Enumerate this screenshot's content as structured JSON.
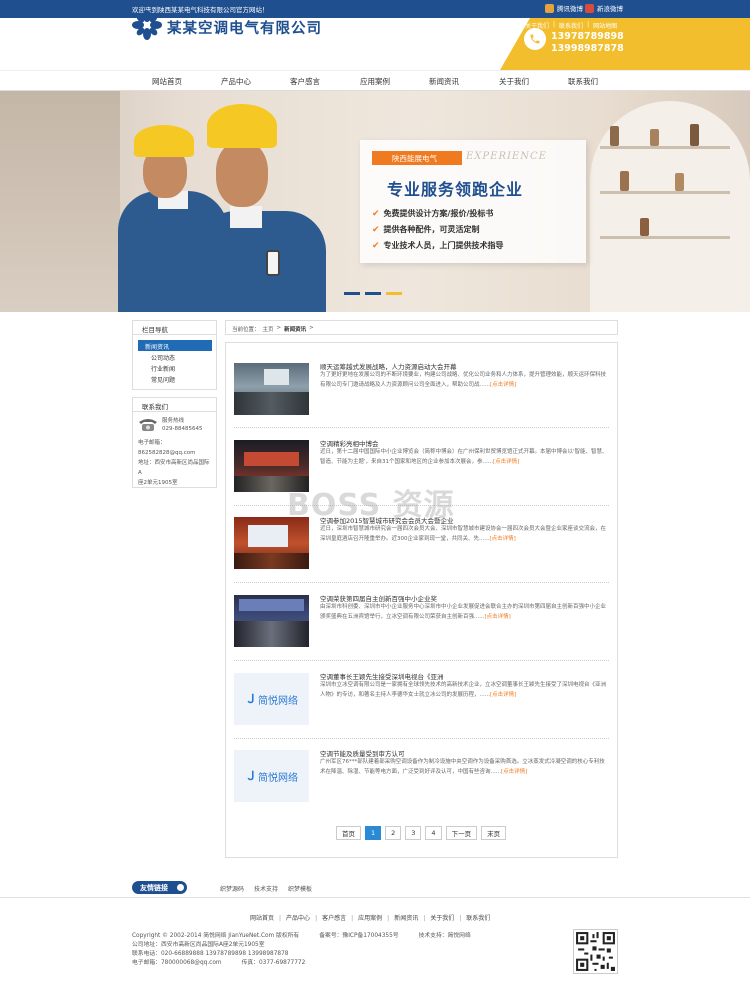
{
  "topbar": {
    "welcome": "欢迎来到陕西某某电气科技有限公司官方网站！",
    "tencent_weibo": "腾讯微博",
    "sina_weibo": "新浪微博"
  },
  "header": {
    "company_name": "某某空调电气有限公司",
    "links": [
      "关于我们",
      "联系我们",
      "网站地图"
    ],
    "phones": [
      "13978789898",
      "13998987878"
    ]
  },
  "nav": [
    "网站首页",
    "产品中心",
    "客户感言",
    "应用案例",
    "新闻资讯",
    "关于我们",
    "联系我们"
  ],
  "banner": {
    "tag": "陕西能展电气",
    "english": "EXPERIENCE",
    "title": "专业服务领跑企业",
    "points": [
      "免费提供设计方案/报价/投标书",
      "提供各种配件，可灵活定制",
      "专业技术人员，上门提供技术指导"
    ]
  },
  "sidebar": {
    "nav_title": "栏目导航",
    "category": "新闻资讯",
    "items": [
      "公司动态",
      "行业新闻",
      "常见问题"
    ],
    "contact_title": "联系我们",
    "hotline_label": "服务热线",
    "hotline": "029-88485645",
    "email_label": "电子邮箱：",
    "email": "862582828@qq.com",
    "address": "地址：西安市高新区尚品国际A",
    "address2": "座2单元1905室"
  },
  "breadcrumb": {
    "label": "当前位置：",
    "home": "主页",
    "current": "新闻资讯"
  },
  "articles": [
    {
      "title": "顺天运筹越式发展战略，人力资源启动大会开幕",
      "desc": "为了更好更地在发展公司的不断环境要业，构建公司战略、优化公司业务和人力体系，提升管理效能，顺天运环保科技有限公司专门邀请战略及人力资源顾问公司全面进入，帮助公司战......",
      "more": "[点击详情]"
    },
    {
      "title": "空调精彩亮相中博会",
      "desc": "近日，第十二届中国国际中小企业博览会（简称中博会）在广州保利世贸博览馆正式开幕。本届中博会以'智能、智慧、智造、节能为主题'，来自31个国家和地区的企业参加本次展会，参......",
      "more": "[点击详情]"
    },
    {
      "title": "空调参加2015智慧城市研究会会员大会暨企业",
      "desc": "近日，深圳市智慧城市研究会一届四次会员大会、深圳市智慧城市建设协会一届四次会员大会暨企业家座谈交流会，在深圳皇庭酒店召开隆重举办。近300企业家到现一堂，共同关、先......",
      "more": "[点击详情]"
    },
    {
      "title": "空调荣获第四届自主创新百强中小企业奖",
      "desc": "由深圳市科创委、深圳市中小企业服务中心深圳市中小企业发展促进会联合主办的深圳市第四届自主创新百强中小企业颁奖盛典在五洲宾馆举行，立冰空调有限公司荣获自主创新百强......",
      "more": "[点击详情]"
    },
    {
      "title": "空调董事长王颖先生接受深圳电视台《亚洲",
      "desc": "深圳市立冰空调有限公司是一家拥有全球领先技术的高新技术企业，立冰空调董事长王颖先生接受了深圳电视台《亚洲人物》的专访，和著名主持人李德华女士就立冰公司的发展历程，......",
      "more": "[点击详情]"
    },
    {
      "title": "空调节能及质量受到审方认可",
      "desc": "广州军区76***部队建着部采购空调设备作为制冷设施中央空调作为设备采购首选。立冰蒸发式冷凝空调的核心专利技术在降温、除湿、节能等电方面，广泛受到好评及认可，中国有些咨询......",
      "more": "[点击详情]"
    }
  ],
  "pagination": [
    "首页",
    "1",
    "2",
    "3",
    "4",
    "下一页",
    "末页"
  ],
  "watermark": "BOSS 资源",
  "links": {
    "badge": "友情链接",
    "items": [
      "织梦源码",
      "技术支持",
      "织梦模板"
    ]
  },
  "footer": {
    "nav": [
      "网站首页",
      "产品中心",
      "客户感言",
      "应用案例",
      "新闻资讯",
      "关于我们",
      "联系我们"
    ],
    "copyright": "Copyright © 2002-2014 简悦网络 JianYueNet.Com 版权所有",
    "icp": "备案号：豫ICP备17004355号",
    "support": "技术支持：简悦网络",
    "address": "公司地址：西安市高新区尚品国际A座2单元1905室",
    "tel": "联系电话：020-66889888   13978789898   13998987878",
    "email": "电子邮箱：780000068@qq.com",
    "fax": "传真：0377-69877772"
  },
  "colors": {
    "primary": "#1f4f8f",
    "accent": "#f07a1f",
    "yellow": "#f2be2d"
  }
}
